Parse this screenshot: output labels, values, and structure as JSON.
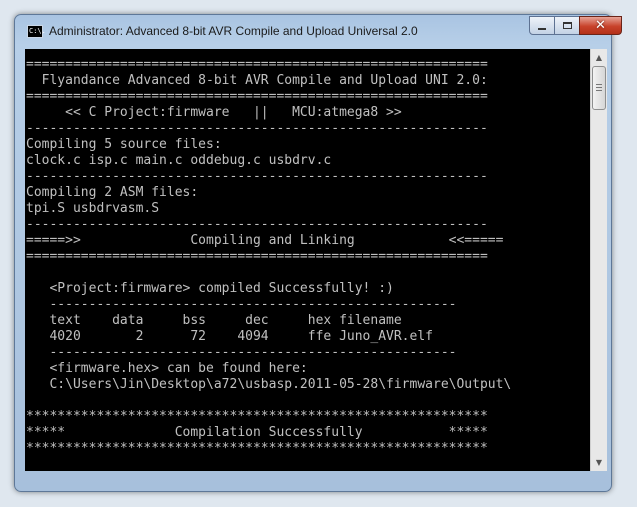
{
  "window": {
    "icon_label": "C:\\.",
    "title": "Administrator:  Advanced 8-bit AVR Compile and Upload Universal 2.0"
  },
  "controls": {
    "minimize_icon": "minimize-icon",
    "maximize_icon": "maximize-icon",
    "close_icon": "close-icon",
    "close_glyph": "✕"
  },
  "console": {
    "lines": [
      "===========================================================",
      "  Flyandance Advanced 8-bit AVR Compile and Upload UNI 2.0:",
      "===========================================================",
      "     << C Project:firmware   ||   MCU:atmega8 >>",
      "-----------------------------------------------------------",
      "Compiling 5 source files:",
      "clock.c isp.c main.c oddebug.c usbdrv.c",
      "-----------------------------------------------------------",
      "Compiling 2 ASM files:",
      "tpi.S usbdrvasm.S",
      "-----------------------------------------------------------",
      "=====>>              Compiling and Linking            <<=====",
      "===========================================================",
      "",
      "   <Project:firmware> compiled Successfully! :)",
      "   ----------------------------------------------------",
      "   text    data     bss     dec     hex filename",
      "   4020       2      72    4094     ffe Juno_AVR.elf",
      "   ----------------------------------------------------",
      "   <firmware.hex> can be found here:",
      "   C:\\Users\\Jin\\Desktop\\a72\\usbasp.2011-05-28\\firmware\\Output\\",
      "",
      "***********************************************************",
      "*****              Compilation Successfully           *****",
      "***********************************************************"
    ]
  },
  "scrollbar": {
    "up_arrow": "▲",
    "down_arrow": "▼",
    "position": 0.0
  }
}
